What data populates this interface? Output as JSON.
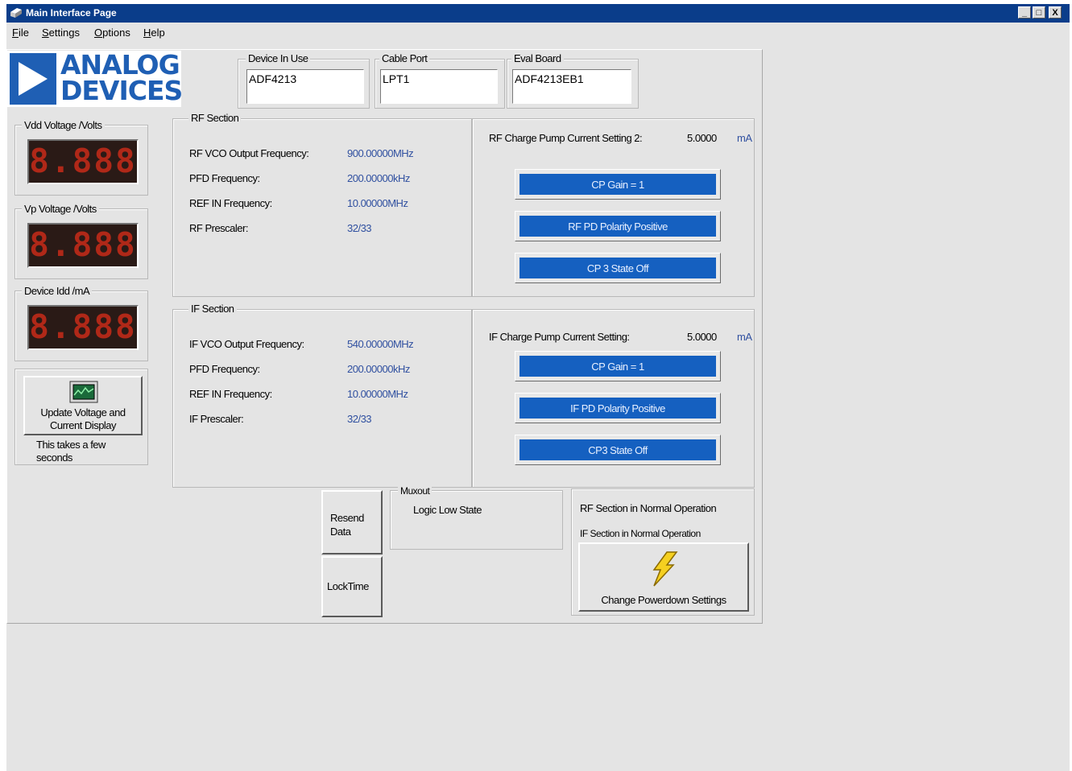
{
  "window": {
    "title": "Main Interface Page",
    "controls": [
      "_",
      "□",
      "X"
    ]
  },
  "menu": [
    "File",
    "Settings",
    "Options",
    "Help"
  ],
  "logo": {
    "line1": "ANALOG",
    "line2": "DEVICES",
    "color": "#1f5fb4"
  },
  "device": {
    "device_in_use_label": "Device In Use",
    "device_in_use": "ADF4213",
    "cable_port_label": "Cable Port",
    "cable_port": "LPT1",
    "eval_board_label": "Eval Board",
    "eval_board": "ADF4213EB1"
  },
  "meters": {
    "vdd_label": "Vdd Voltage /Volts",
    "vdd_value": "8.888",
    "vp_label": "Vp Voltage /Volts",
    "vp_value": "8.888",
    "idd_label": "Device Idd /mA",
    "idd_value": "8.888",
    "update_button": "Update Voltage and Current Display",
    "update_note": "This takes a few seconds"
  },
  "rf": {
    "section_label": "RF Section",
    "rows": [
      {
        "label": "RF VCO Output Frequency:",
        "value": "900.00000MHz"
      },
      {
        "label": "PFD Frequency:",
        "value": "200.00000kHz"
      },
      {
        "label": "REF IN Frequency:",
        "value": "10.00000MHz"
      },
      {
        "label": "RF Prescaler:",
        "value": "32/33"
      }
    ],
    "cp_label": "RF Charge Pump Current Setting 2:",
    "cp_value": "5.0000",
    "cp_unit": "mA",
    "buttons": [
      "CP Gain = 1",
      "RF PD Polarity Positive",
      "CP 3 State Off"
    ]
  },
  "if": {
    "section_label": "IF Section",
    "rows": [
      {
        "label": "IF VCO Output Frequency:",
        "value": "540.00000MHz"
      },
      {
        "label": "PFD Frequency:",
        "value": "200.00000kHz"
      },
      {
        "label": "REF IN Frequency:",
        "value": "10.00000MHz"
      },
      {
        "label": "IF Prescaler:",
        "value": "32/33"
      }
    ],
    "cp_label": "IF Charge Pump Current Setting:",
    "cp_value": "5.0000",
    "cp_unit": "mA",
    "buttons": [
      "CP Gain = 1",
      "IF PD Polarity Positive",
      "CP3 State Off"
    ]
  },
  "actions": {
    "resend": "Resend Data",
    "locktime": "LockTime"
  },
  "muxout": {
    "label": "Muxout",
    "value": "Logic Low State"
  },
  "status": {
    "rf": "RF Section in Normal Operation",
    "if": "IF Section in Normal Operation",
    "powerdown_button": "Change Powerdown Settings"
  }
}
